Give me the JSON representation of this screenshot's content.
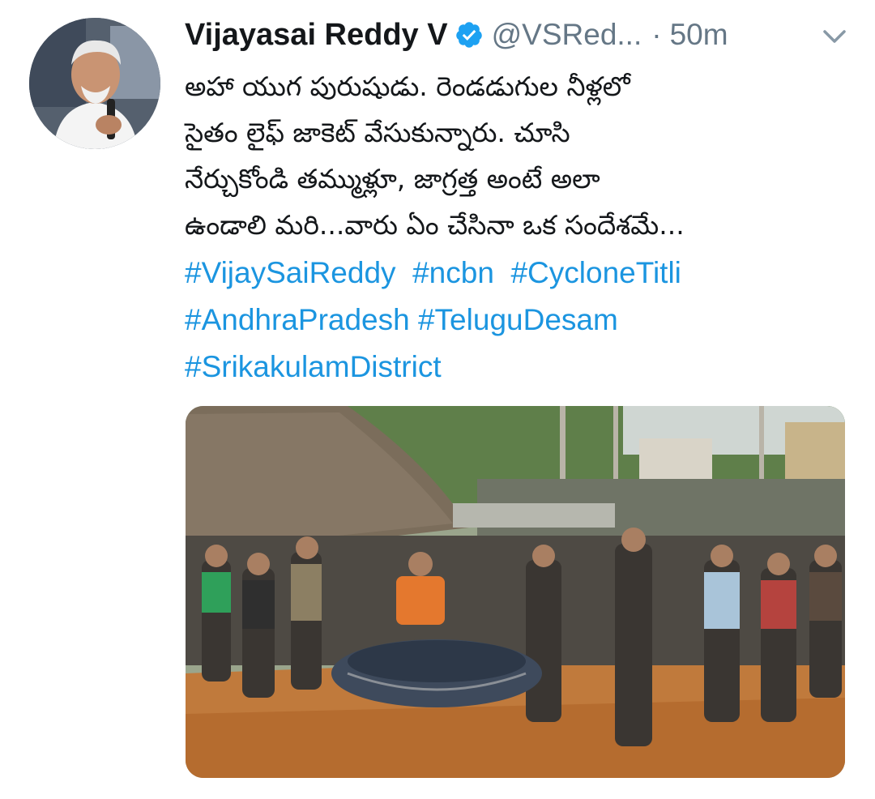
{
  "tweet": {
    "display_name": "Vijayasai Reddy V",
    "handle": "@VSRed...",
    "separator": "·",
    "timestamp": "50m",
    "body_lines": [
      "అహా యుగ పురుషుడు. రెండడుగుల నీళ్లలో",
      "సైతం లైఫ్ జాకెట్ వేసుకున్నారు. చూసి",
      "నేర్చుకోండి తమ్ముళ్లూ, జాగ్రత్త అంటే అలా",
      "ఉండాలి మరి...వారు ఏం చేసినా ఒక సందేశమే..."
    ],
    "hashtags": [
      [
        "#VijaySaiReddy",
        "#ncbn",
        "#CycloneTitli"
      ],
      [
        "#AndhraPradesh",
        "#TeluguDesam"
      ],
      [
        "#SrikakulamDistrict"
      ]
    ]
  },
  "icons": {
    "verified": "verified-badge-icon",
    "menu": "chevron-down-icon"
  },
  "colors": {
    "name": "#14171a",
    "meta": "#657786",
    "hashtag": "#1b95e0",
    "verified": "#1da1f2"
  }
}
